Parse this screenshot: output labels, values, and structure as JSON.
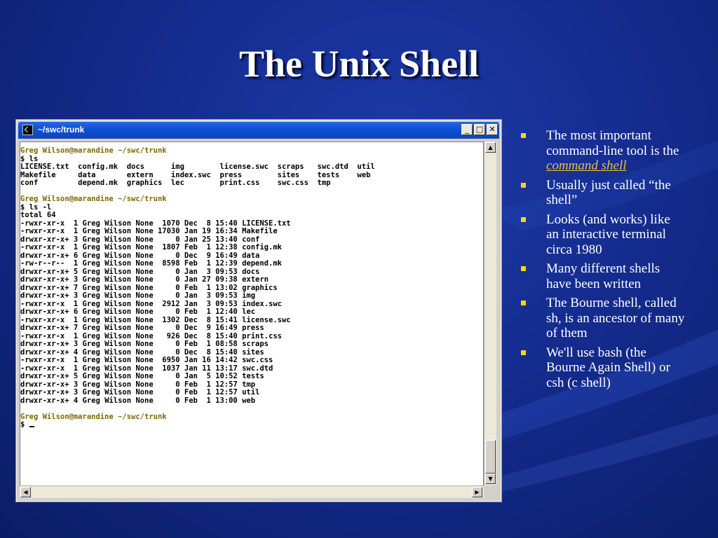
{
  "slide": {
    "title": "The Unix Shell"
  },
  "terminal": {
    "window_title": "~/swc/trunk",
    "lines": [
      {
        "prompt": "Greg Wilson@marandine ~/swc/trunk"
      },
      {
        "text": "$ ls"
      },
      {
        "text": "LICENSE.txt  config.mk  docs      img        license.swc  scraps   swc.dtd  util"
      },
      {
        "text": "Makefile     data       extern    index.swc  press        sites    tests    web"
      },
      {
        "text": "conf         depend.mk  graphics  lec        print.css    swc.css  tmp"
      },
      {
        "text": ""
      },
      {
        "prompt": "Greg Wilson@marandine ~/swc/trunk"
      },
      {
        "text": "$ ls -l"
      },
      {
        "text": "total 64"
      },
      {
        "text": "-rwxr-xr-x  1 Greg Wilson None  1070 Dec  8 15:40 LICENSE.txt"
      },
      {
        "text": "-rwxr-xr-x  1 Greg Wilson None 17030 Jan 19 16:34 Makefile"
      },
      {
        "text": "drwxr-xr-x+ 3 Greg Wilson None     0 Jan 25 13:40 conf"
      },
      {
        "text": "-rwxr-xr-x  1 Greg Wilson None  1807 Feb  1 12:38 config.mk"
      },
      {
        "text": "drwxr-xr-x+ 6 Greg Wilson None     0 Dec  9 16:49 data"
      },
      {
        "text": "-rw-r--r--  1 Greg Wilson None  8598 Feb  1 12:39 depend.mk"
      },
      {
        "text": "drwxr-xr-x+ 5 Greg Wilson None     0 Jan  3 09:53 docs"
      },
      {
        "text": "drwxr-xr-x+ 3 Greg Wilson None     0 Jan 27 09:38 extern"
      },
      {
        "text": "drwxr-xr-x+ 7 Greg Wilson None     0 Feb  1 13:02 graphics"
      },
      {
        "text": "drwxr-xr-x+ 3 Greg Wilson None     0 Jan  3 09:53 img"
      },
      {
        "text": "-rwxr-xr-x  1 Greg Wilson None  2912 Jan  3 09:53 index.swc"
      },
      {
        "text": "drwxr-xr-x+ 6 Greg Wilson None     0 Feb  1 12:40 lec"
      },
      {
        "text": "-rwxr-xr-x  1 Greg Wilson None  1302 Dec  8 15:41 license.swc"
      },
      {
        "text": "drwxr-xr-x+ 7 Greg Wilson None     0 Dec  9 16:49 press"
      },
      {
        "text": "-rwxr-xr-x  1 Greg Wilson None   926 Dec  8 15:40 print.css"
      },
      {
        "text": "drwxr-xr-x+ 3 Greg Wilson None     0 Feb  1 08:58 scraps"
      },
      {
        "text": "drwxr-xr-x+ 4 Greg Wilson None     0 Dec  8 15:40 sites"
      },
      {
        "text": "-rwxr-xr-x  1 Greg Wilson None  6950 Jan 16 14:42 swc.css"
      },
      {
        "text": "-rwxr-xr-x  1 Greg Wilson None  1037 Jan 11 13:17 swc.dtd"
      },
      {
        "text": "drwxr-xr-x+ 5 Greg Wilson None     0 Jan  5 10:52 tests"
      },
      {
        "text": "drwxr-xr-x+ 3 Greg Wilson None     0 Feb  1 12:57 tmp"
      },
      {
        "text": "drwxr-xr-x+ 3 Greg Wilson None     0 Feb  1 12:57 util"
      },
      {
        "text": "drwxr-xr-x+ 4 Greg Wilson None     0 Feb  1 13:00 web"
      },
      {
        "text": ""
      },
      {
        "prompt": "Greg Wilson@marandine ~/swc/trunk"
      },
      {
        "text": "$ ",
        "cursor": true
      }
    ],
    "colors": {
      "prompt": "#806600",
      "background": "#ffffff",
      "titlebar": "#0d52d6"
    }
  },
  "bullets": [
    {
      "text": "The most important command-line tool is the ",
      "link": "command shell"
    },
    {
      "text": "Usually just called “the shell”"
    },
    {
      "text": "Looks (and works) like an interactive terminal circa 1980"
    },
    {
      "text": "Many different shells have been written"
    },
    {
      "text": "The Bourne shell, called sh, is an ancestor of many of them"
    },
    {
      "text": "We'll use bash (the Bourne Again Shell) or csh (c shell)"
    }
  ],
  "theme": {
    "background": "#142c8e",
    "bullet_color": "#ffd700",
    "link_color": "#e8c030"
  }
}
